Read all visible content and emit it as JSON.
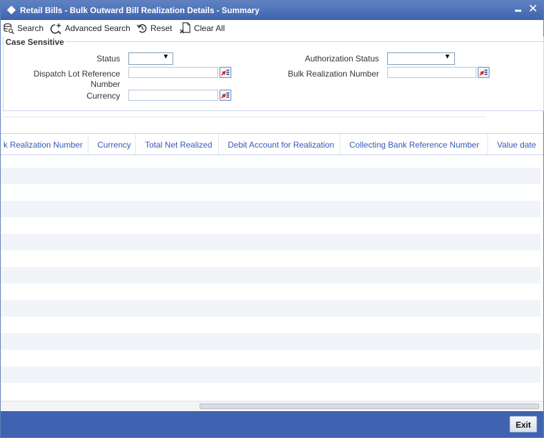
{
  "window": {
    "title": "Retail Bills - Bulk Outward Bill Realization Details - Summary"
  },
  "toolbar": {
    "search_label": "Search",
    "advanced_search_label": "Advanced Search",
    "reset_label": "Reset",
    "clear_all_label": "Clear All"
  },
  "criteria": {
    "legend": "Case Sensitive",
    "status_label": "Status",
    "status_value": "",
    "dispatch_label_line1": "Dispatch Lot Reference",
    "dispatch_label_line2": "Number",
    "dispatch_value": "",
    "currency_label": "Currency",
    "currency_value": "",
    "auth_status_label": "Authorization Status",
    "auth_status_value": "",
    "bulk_realization_label": "Bulk Realization Number",
    "bulk_realization_value": ""
  },
  "grid": {
    "columns": [
      "k Realization Number",
      "Currency",
      "Total Net Realized",
      "Debit Account for Realization",
      "Collecting Bank Reference Number",
      "Value date"
    ]
  },
  "footer": {
    "exit_label": "Exit"
  },
  "icons": {
    "window": "diamond-icon",
    "minimize": "minimize-icon",
    "close": "close-icon",
    "search": "search-database-icon",
    "advanced_search": "advanced-search-icon",
    "reset": "reset-icon",
    "clear_all": "clear-all-icon",
    "lov": "list-of-values-icon",
    "dropdown": "chevron-down-icon"
  },
  "colors": {
    "title_bar": "#4a6db5",
    "footer": "#3f63b0",
    "header_text": "#3559b5",
    "row_alt": "#f1f4f9"
  }
}
